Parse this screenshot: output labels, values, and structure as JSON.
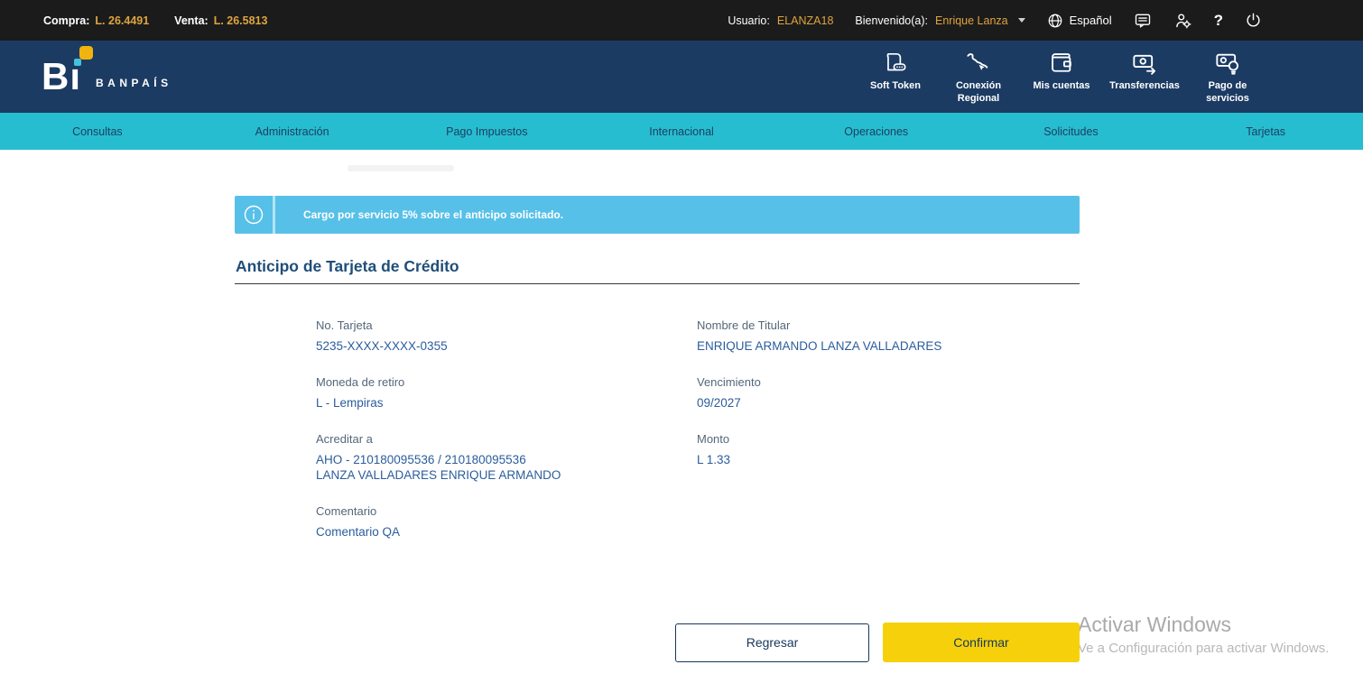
{
  "topbar": {
    "compra_label": "Compra:",
    "compra_value": "L. 26.4491",
    "venta_label": "Venta:",
    "venta_value": "L. 26.5813",
    "usuario_label": "Usuario:",
    "usuario_value": "ELANZA18",
    "welcome_label": "Bienvenido(a):",
    "welcome_value": "Enrique Lanza",
    "language_label": "Español",
    "help_label": "?"
  },
  "header": {
    "logo": {
      "mark_b": "B",
      "mark_i": "ı",
      "brand": "BANPAÍS"
    },
    "menu": [
      {
        "label": "Soft Token",
        "icon": "soft-token-icon"
      },
      {
        "label": "Conexión Regional",
        "icon": "regional-connection-icon"
      },
      {
        "label": "Mis cuentas",
        "icon": "wallet-icon"
      },
      {
        "label": "Transferencias",
        "icon": "money-transfer-icon"
      },
      {
        "label": "Pago de servicios",
        "icon": "bill-pay-icon"
      }
    ]
  },
  "nav": {
    "items": [
      "Consultas",
      "Administración",
      "Pago Impuestos",
      "Internacional",
      "Operaciones",
      "Solicitudes",
      "Tarjetas"
    ]
  },
  "banner": {
    "icon": "info-icon",
    "message": "Cargo por servicio 5% sobre el anticipo solicitado."
  },
  "page": {
    "title": "Anticipo de Tarjeta de Crédito"
  },
  "form": {
    "fields": [
      {
        "label": "No. Tarjeta",
        "value": "5235-XXXX-XXXX-0355"
      },
      {
        "label": "Nombre de Titular",
        "value": "ENRIQUE ARMANDO LANZA VALLADARES"
      },
      {
        "label": "Moneda de retiro",
        "value": "L - Lempiras"
      },
      {
        "label": "Vencimiento",
        "value": "09/2027"
      },
      {
        "label": "Acreditar a",
        "value": "AHO - 210180095536 / 210180095536",
        "value2": "LANZA VALLADARES ENRIQUE ARMANDO"
      },
      {
        "label": "Monto",
        "value": "L 1.33"
      },
      {
        "label": "Comentario",
        "value": "Comentario QA"
      }
    ]
  },
  "actions": {
    "back": "Regresar",
    "confirm": "Confirmar"
  },
  "watermark": {
    "line1": "Activar Windows",
    "line2": "Ve a Configuración para activar Windows."
  },
  "colors": {
    "topbar_bg": "#1b1b1b",
    "header_navy": "#1c3b63",
    "subnav_cyan": "#27bdd1",
    "banner_blue": "#57c0e8",
    "accent_orange": "#dfa43e",
    "title_blue": "#1f4e79",
    "label_slate": "#54677a",
    "value_blue": "#2b5d9c",
    "confirm_yellow": "#f6d10b"
  }
}
